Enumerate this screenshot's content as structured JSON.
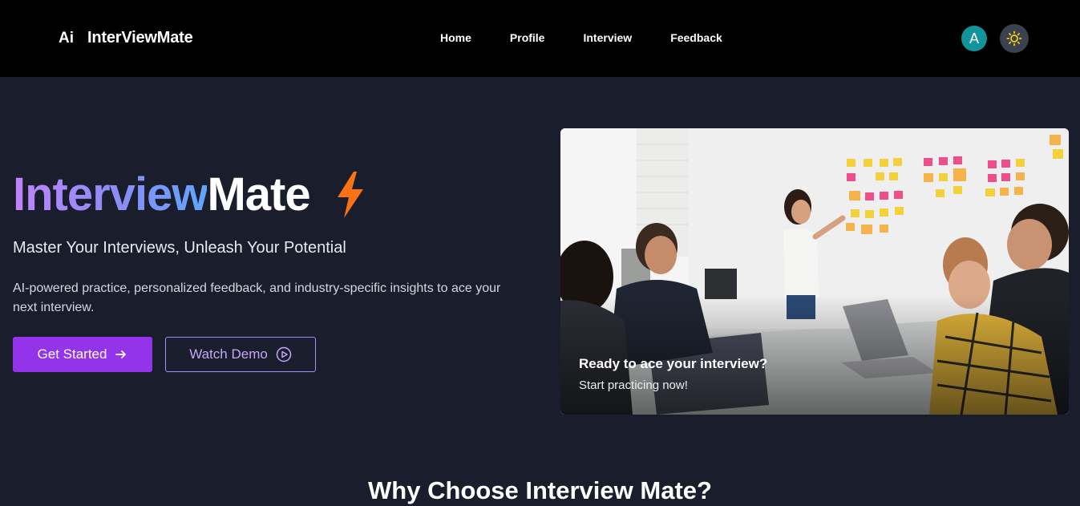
{
  "header": {
    "brand_mark": "Ai",
    "brand_name": "InterViewMate",
    "nav": [
      {
        "label": "Home"
      },
      {
        "label": "Profile"
      },
      {
        "label": "Interview"
      },
      {
        "label": "Feedback"
      }
    ],
    "avatar_initial": "A",
    "theme_toggle_icon": "sun-icon"
  },
  "hero": {
    "title_gradient": "Interview",
    "title_plain": "Mate",
    "title_icon": "lightning-bolt-icon",
    "subtitle": "Master Your Interviews, Unleash Your Potential",
    "description": "AI-powered practice, personalized feedback, and industry-specific insights to ace your next interview.",
    "primary_button": "Get Started",
    "primary_button_icon": "arrow-right-icon",
    "secondary_button": "Watch Demo",
    "secondary_button_icon": "play-circle-icon",
    "card_heading": "Ready to ace your interview?",
    "card_subtext": "Start practicing now!"
  },
  "features": {
    "title": "Why Choose Interview Mate?"
  },
  "colors": {
    "background": "#1a1e2c",
    "header": "#000000",
    "primary": "#9333ea",
    "accent_bolt": "#f97316",
    "avatar": "#11949b"
  }
}
